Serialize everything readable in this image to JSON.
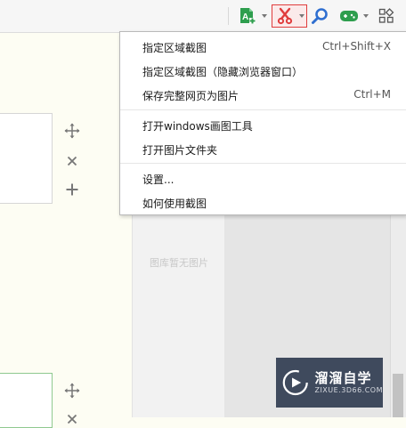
{
  "toolbar": {
    "icons": [
      "add-file-icon",
      "scissors-icon",
      "search-icon",
      "gamepad-icon",
      "apps-grid-icon"
    ],
    "accent": "#2e9e4e",
    "highlight": "#e03c3c"
  },
  "menu": {
    "items": [
      {
        "label": "指定区域截图",
        "shortcut": "Ctrl+Shift+X"
      },
      {
        "label": "指定区域截图（隐藏浏览器窗口）",
        "shortcut": ""
      },
      {
        "label": "保存完整网页为图片",
        "shortcut": "Ctrl+M"
      },
      {
        "label": "打开windows画图工具",
        "shortcut": ""
      },
      {
        "label": "打开图片文件夹",
        "shortcut": ""
      },
      {
        "label": "设置...",
        "shortcut": ""
      },
      {
        "label": "如何使用截图",
        "shortcut": ""
      }
    ]
  },
  "gallery": {
    "empty_text": "图库暂无图片"
  },
  "watermark": {
    "main": "溜溜自学",
    "sub": "ZIXUE.3D66.COM"
  }
}
